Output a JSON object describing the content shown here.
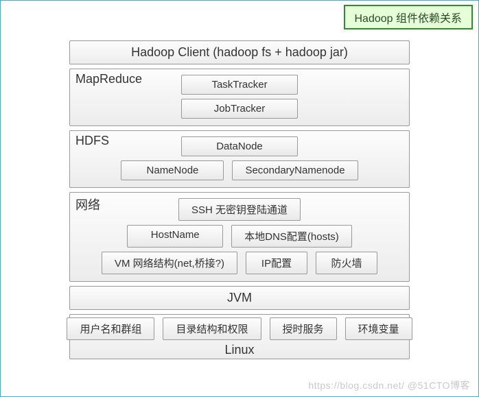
{
  "title": "Hadoop 组件依赖关系",
  "client_bar": "Hadoop Client (hadoop fs + hadoop jar)",
  "mapreduce": {
    "label": "MapReduce",
    "tasktracker": "TaskTracker",
    "jobtracker": "JobTracker"
  },
  "hdfs": {
    "label": "HDFS",
    "datanode": "DataNode",
    "namenode": "NameNode",
    "secondary": "SecondaryNamenode"
  },
  "network": {
    "label": "网络",
    "ssh": "SSH 无密钥登陆通道",
    "hostname": "HostName",
    "localdns": "本地DNS配置(hosts)",
    "vm_net": "VM 网络结构(net,桥接?)",
    "ip": "IP配置",
    "firewall": "防火墙"
  },
  "jvm": {
    "label": "JVM"
  },
  "linux": {
    "label": "Linux",
    "usergroup": "用户名和群组",
    "dirs": "目录结构和权限",
    "time": "授时服务",
    "env": "环境变量"
  },
  "watermark": "https://blog.csdn.net/  @51CTO博客"
}
